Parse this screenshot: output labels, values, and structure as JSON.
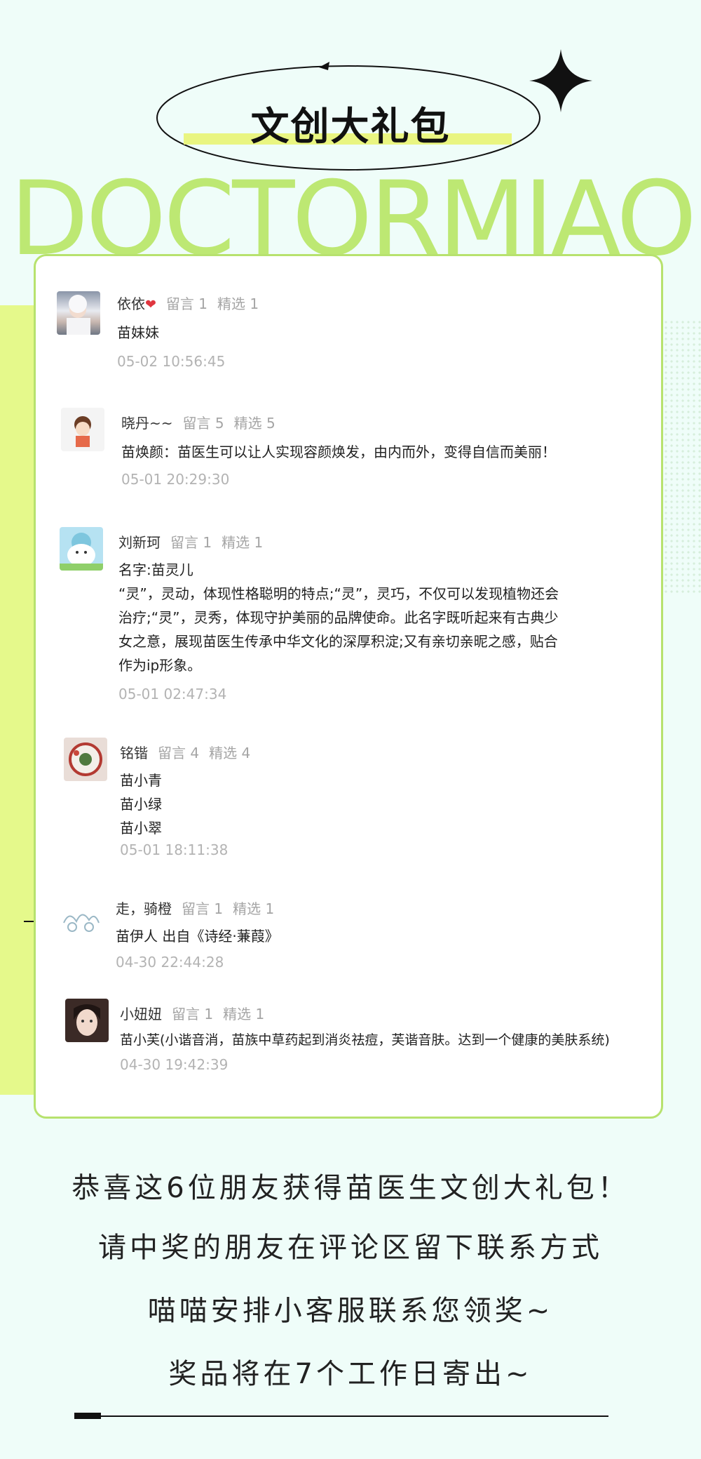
{
  "header": {
    "title": "文创大礼包",
    "brand": "DOCTORMIAO"
  },
  "comments": [
    {
      "name": "依依",
      "heart": "❤",
      "replies": "留言 1",
      "picks": "精选 1",
      "lines": [
        "苗妹妹"
      ],
      "time": "05-02 10:56:45",
      "avatar": "avatar-photo-girl-winter"
    },
    {
      "name": "晓丹~~",
      "replies": "留言 5",
      "picks": "精选 5",
      "lines": [
        "苗焕颜：苗医生可以让人实现容颜焕发，由内而外，变得自信而美丽！"
      ],
      "time": "05-01 20:29:30",
      "avatar": "avatar-cartoon-boy"
    },
    {
      "name": "刘新珂",
      "replies": "留言 1",
      "picks": "精选 1",
      "lines": [
        "名字:苗灵儿",
        "“灵”，灵动，体现性格聪明的特点;“灵”，灵巧，不仅可以发现植物还会",
        "治疗;“灵”，灵秀，体现守护美丽的品牌使命。此名字既听起来有古典少",
        "女之意，展现苗医生传承中华文化的深厚积淀;又有亲切亲昵之感，贴合",
        "作为ip形象。"
      ],
      "time": "05-01 02:47:34",
      "avatar": "avatar-cartoon-bear"
    },
    {
      "name": "铭锴",
      "replies": "留言 4",
      "picks": "精选 4",
      "lines": [
        "苗小青",
        "苗小绿",
        "苗小翠"
      ],
      "time": "05-01 18:11:38",
      "avatar": "avatar-cake"
    },
    {
      "name": "走，骑橙",
      "replies": "留言 1",
      "picks": "精选 1",
      "lines": [
        "苗伊人  出自《诗经·蒹葭》"
      ],
      "time": "04-30 22:44:28",
      "avatar": "avatar-sketch"
    },
    {
      "name": "小妞妞",
      "replies": "留言 1",
      "picks": "精选 1",
      "lines": [
        "苗小芙(小谐音消，苗族中草药起到消炎祛痘，芙谐音肤。达到一个健康的美肤系统)"
      ],
      "time": "04-30 19:42:39",
      "avatar": "avatar-photo-girl"
    }
  ],
  "footer": {
    "line1": "恭喜这6位朋友获得苗医生文创大礼包！",
    "line2": "请中奖的朋友在评论区留下联系方式",
    "line3": "喵喵安排小客服联系您领奖~",
    "line4": "奖品将在7个工作日寄出~"
  },
  "colors": {
    "background": "#effdf9",
    "accent_green": "#bde873",
    "accent_yellow": "#e5f98b"
  }
}
